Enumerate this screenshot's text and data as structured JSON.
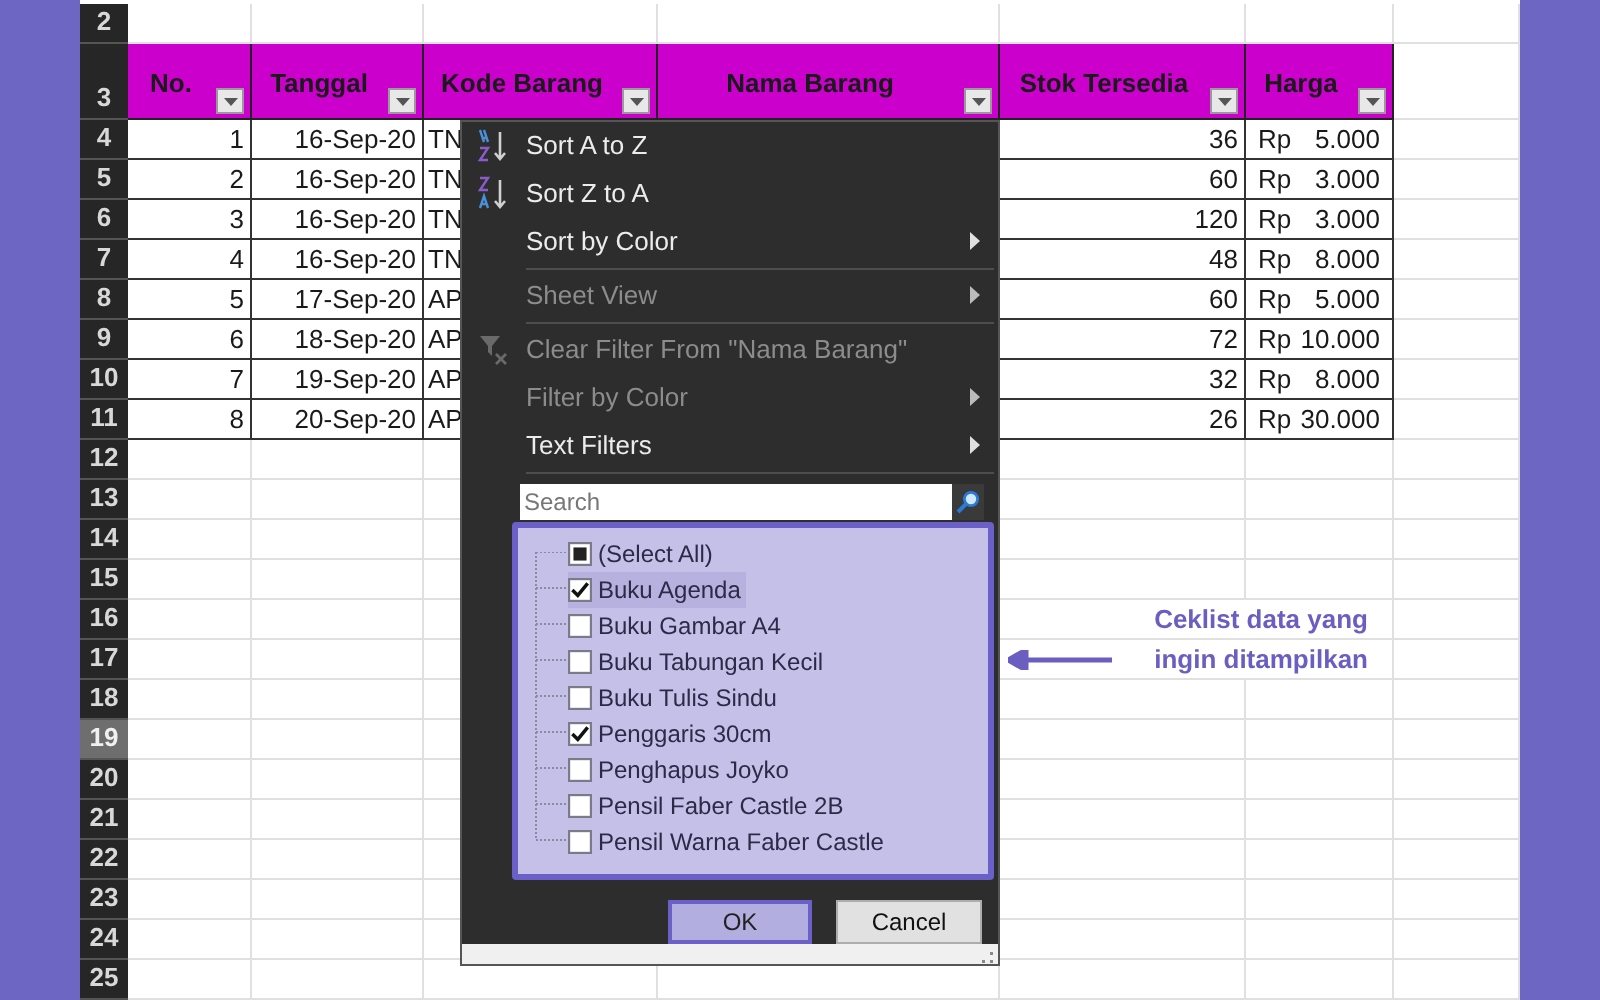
{
  "row_headers": [
    {
      "label": "2",
      "selected": false
    },
    {
      "label": "3",
      "selected": false
    },
    {
      "label": "4",
      "selected": false
    },
    {
      "label": "5",
      "selected": false
    },
    {
      "label": "6",
      "selected": false
    },
    {
      "label": "7",
      "selected": false
    },
    {
      "label": "8",
      "selected": false
    },
    {
      "label": "9",
      "selected": false
    },
    {
      "label": "10",
      "selected": false
    },
    {
      "label": "11",
      "selected": false
    },
    {
      "label": "12",
      "selected": false
    },
    {
      "label": "13",
      "selected": false
    },
    {
      "label": "14",
      "selected": false
    },
    {
      "label": "15",
      "selected": false
    },
    {
      "label": "16",
      "selected": false
    },
    {
      "label": "17",
      "selected": false
    },
    {
      "label": "18",
      "selected": false
    },
    {
      "label": "19",
      "selected": true
    },
    {
      "label": "20",
      "selected": false
    },
    {
      "label": "21",
      "selected": false
    },
    {
      "label": "22",
      "selected": false
    },
    {
      "label": "23",
      "selected": false
    },
    {
      "label": "24",
      "selected": false
    },
    {
      "label": "25",
      "selected": false
    }
  ],
  "table": {
    "columns": [
      {
        "label": "No."
      },
      {
        "label": "Tanggal"
      },
      {
        "label": "Kode Barang"
      },
      {
        "label": "Nama Barang"
      },
      {
        "label": "Stok Tersedia"
      },
      {
        "label": "Harga"
      }
    ],
    "rows": [
      {
        "no": "1",
        "tanggal": "16-Sep-20",
        "kode": "TN",
        "stok": "36",
        "currency": "Rp",
        "harga": "5.000"
      },
      {
        "no": "2",
        "tanggal": "16-Sep-20",
        "kode": "TN",
        "stok": "60",
        "currency": "Rp",
        "harga": "3.000"
      },
      {
        "no": "3",
        "tanggal": "16-Sep-20",
        "kode": "TN",
        "stok": "120",
        "currency": "Rp",
        "harga": "3.000"
      },
      {
        "no": "4",
        "tanggal": "16-Sep-20",
        "kode": "TN",
        "stok": "48",
        "currency": "Rp",
        "harga": "8.000"
      },
      {
        "no": "5",
        "tanggal": "17-Sep-20",
        "kode": "AP",
        "stok": "60",
        "currency": "Rp",
        "harga": "5.000"
      },
      {
        "no": "6",
        "tanggal": "18-Sep-20",
        "kode": "AP",
        "stok": "72",
        "currency": "Rp",
        "harga": "10.000"
      },
      {
        "no": "7",
        "tanggal": "19-Sep-20",
        "kode": "AP",
        "stok": "32",
        "currency": "Rp",
        "harga": "8.000"
      },
      {
        "no": "8",
        "tanggal": "20-Sep-20",
        "kode": "AP",
        "stok": "26",
        "currency": "Rp",
        "harga": "30.000"
      }
    ]
  },
  "filter_menu": {
    "items": [
      {
        "kind": "sort_ascending",
        "label": "Sort A to Z",
        "disabled": false,
        "submenu": false
      },
      {
        "kind": "sort_descending",
        "label": "Sort Z to A",
        "disabled": false,
        "submenu": false
      },
      {
        "kind": "item",
        "label": "Sort by Color",
        "disabled": false,
        "submenu": true
      },
      {
        "kind": "separator"
      },
      {
        "kind": "item",
        "label": "Sheet View",
        "disabled": true,
        "submenu": true
      },
      {
        "kind": "separator"
      },
      {
        "kind": "clear_filter",
        "label": "Clear Filter From \"Nama Barang\"",
        "disabled": true,
        "submenu": false
      },
      {
        "kind": "item",
        "label": "Filter by Color",
        "disabled": true,
        "submenu": true
      },
      {
        "kind": "item",
        "label": "Text Filters",
        "disabled": false,
        "submenu": true
      },
      {
        "kind": "separator"
      }
    ],
    "search": {
      "placeholder": "Search"
    },
    "values": [
      {
        "label": "(Select All)",
        "checked": false,
        "mixed": true,
        "selected": false
      },
      {
        "label": "Buku Agenda",
        "checked": true,
        "mixed": false,
        "selected": true
      },
      {
        "label": "Buku Gambar A4",
        "checked": false,
        "mixed": false,
        "selected": false
      },
      {
        "label": "Buku Tabungan Kecil",
        "checked": false,
        "mixed": false,
        "selected": false
      },
      {
        "label": "Buku Tulis Sindu",
        "checked": false,
        "mixed": false,
        "selected": false
      },
      {
        "label": "Penggaris 30cm",
        "checked": true,
        "mixed": false,
        "selected": false
      },
      {
        "label": "Penghapus Joyko",
        "checked": false,
        "mixed": false,
        "selected": false
      },
      {
        "label": "Pensil Faber Castle 2B",
        "checked": false,
        "mixed": false,
        "selected": false
      },
      {
        "label": "Pensil Warna Faber Castle",
        "checked": false,
        "mixed": false,
        "selected": false
      }
    ],
    "buttons": [
      {
        "label": "OK",
        "kind": "primary"
      },
      {
        "label": "Cancel",
        "kind": "secondary"
      }
    ]
  },
  "annotation": {
    "lines": [
      "Ceklist data yang",
      "ingin ditampilkan"
    ]
  }
}
